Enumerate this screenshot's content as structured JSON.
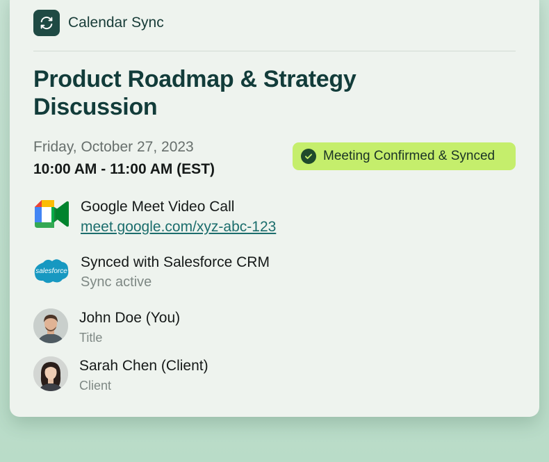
{
  "app": {
    "title": "Calendar Sync",
    "icon": "sync-arrows-icon"
  },
  "event": {
    "title": "Product Roadmap & Strategy Discussion",
    "date": "Friday, October 27, 2023",
    "time": "10:00 AM - 11:00 AM (EST)"
  },
  "status": {
    "label": "Meeting Confirmed & Synced",
    "color": "#c5ee6c",
    "icon": "check-circle-icon"
  },
  "video": {
    "label": "Google Meet Video Call",
    "link": "meet.google.com/xyz-abc-123",
    "icon": "google-meet-icon"
  },
  "crm": {
    "label": "Synced with Salesforce CRM",
    "status": "Sync active",
    "logo_text": "salesforce",
    "icon": "salesforce-icon"
  },
  "attendees": [
    {
      "name": "John Doe (You)",
      "role": "Title"
    },
    {
      "name": "Sarah Chen (Client)",
      "role": "Client"
    }
  ],
  "colors": {
    "accent": "#1f4a44",
    "title": "#123c3a",
    "link": "#1b6d6c"
  }
}
